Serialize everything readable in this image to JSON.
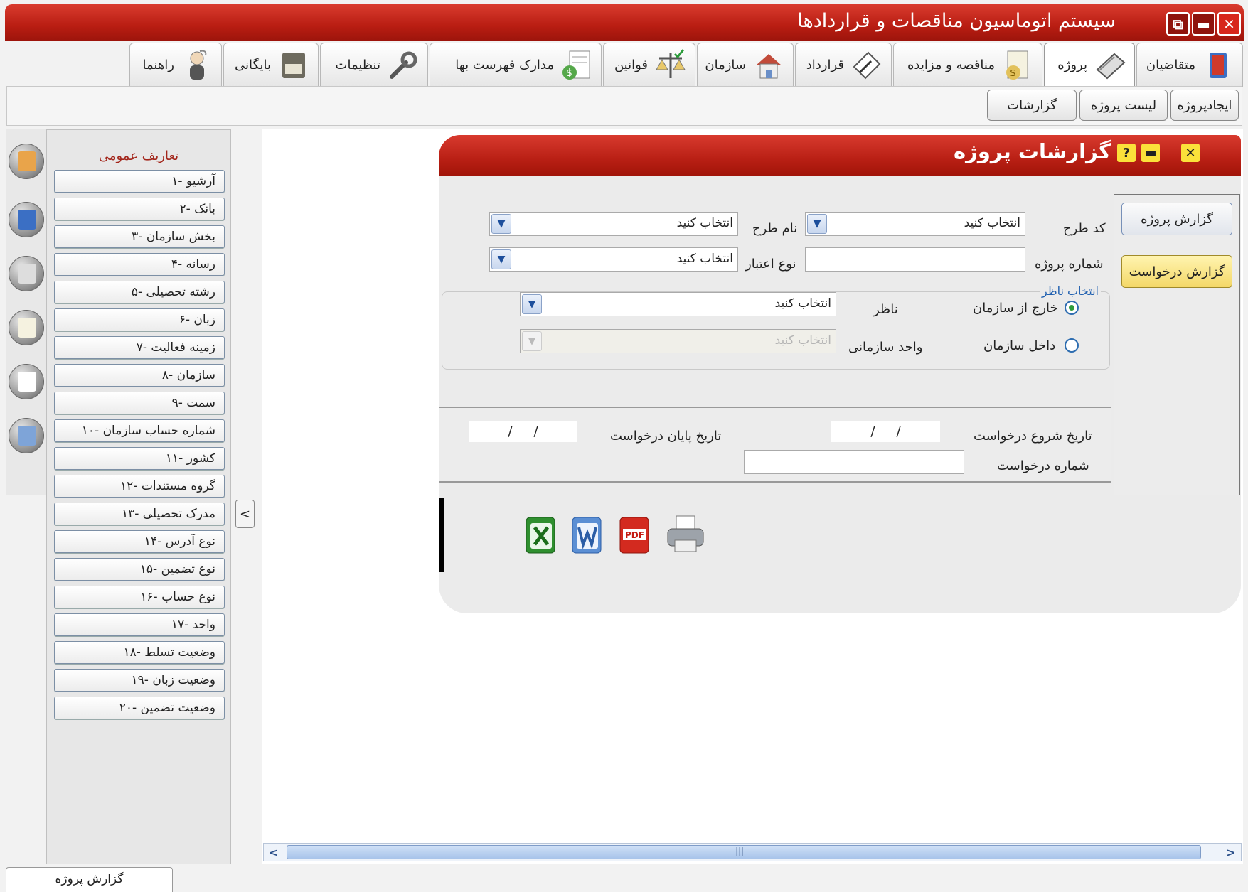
{
  "window": {
    "title": "سیستم اتوماسیون مناقصات و قراردادها"
  },
  "main_tabs": [
    {
      "label": "متقاضیان"
    },
    {
      "label": "پروژه"
    },
    {
      "label": "مناقصه و مزایده"
    },
    {
      "label": "قرارداد"
    },
    {
      "label": "سازمان"
    },
    {
      "label": "قوانین"
    },
    {
      "label": "مدارک فهرست بها"
    },
    {
      "label": "تنظیمات"
    },
    {
      "label": "بایگانی"
    },
    {
      "label": "راهنما"
    }
  ],
  "sub_toolbar": [
    {
      "label": "ایجادپروژه"
    },
    {
      "label": "لیست پروژه"
    },
    {
      "label": "گزارشات"
    }
  ],
  "definitions": {
    "header": "تعاریف عمومی",
    "items": [
      {
        "label": "۱- آرشیو"
      },
      {
        "label": "۲- بانک"
      },
      {
        "label": "۳- بخش سازمان"
      },
      {
        "label": "۴- رسانه"
      },
      {
        "label": "۵- رشته تحصیلی"
      },
      {
        "label": "۶- زبان"
      },
      {
        "label": "۷- زمینه فعالیت"
      },
      {
        "label": "۸- سازمان"
      },
      {
        "label": "۹- سمت"
      },
      {
        "label": "۱۰- شماره حساب سازمان"
      },
      {
        "label": "۱۱- کشور"
      },
      {
        "label": "۱۲- گروه مستندات"
      },
      {
        "label": "۱۳- مدرک تحصیلی"
      },
      {
        "label": "۱۴- نوع آدرس"
      },
      {
        "label": "۱۵- نوع تضمین"
      },
      {
        "label": "۱۶- نوع حساب"
      },
      {
        "label": "۱۷- واحد"
      },
      {
        "label": "۱۸- وضعیت تسلط"
      },
      {
        "label": "۱۹- وضعیت زبان"
      },
      {
        "label": "۲۰- وضعیت تضمین"
      }
    ]
  },
  "collapse_glyph": "<",
  "report_window": {
    "title": "گزارشات پروژه",
    "side_buttons": [
      {
        "label": "گزارش پروژه"
      },
      {
        "label": "گزارش درخواست"
      }
    ],
    "fields": {
      "plan_code_label": "کد طرح",
      "plan_code_value": "انتخاب کنید",
      "plan_name_label": "نام طرح",
      "plan_name_value": "انتخاب کنید",
      "project_number_label": "شماره پروژه",
      "credit_type_label": "نوع اعتبار",
      "credit_type_value": "انتخاب کنید"
    },
    "observer": {
      "legend": "انتخاب ناظر",
      "outside_label": "خارج از سازمان",
      "inside_label": "داخل سازمان",
      "observer_label": "ناظر",
      "observer_value": "انتخاب کنید",
      "unit_label": "واحد سازمانی",
      "unit_value": "انتخاب کنید"
    },
    "request": {
      "start_date_label": "تاریخ شروع درخواست",
      "end_date_label": "تاریخ پایان درخواست",
      "number_label": "شماره درخواست",
      "date_sep": "/"
    }
  },
  "bottom_tab": {
    "label": "گزارش پروژه"
  },
  "icons": {
    "close": "✕",
    "minimize": "▬",
    "restore": "⧉",
    "help": "?",
    "dropdown": "⌄",
    "scroll_left": "<",
    "scroll_right": ">",
    "scroll_grip": "|||"
  },
  "colors": {
    "title_red": "#c0271b",
    "accent_yellow": "#f4d868",
    "legend_blue": "#2060b0"
  }
}
